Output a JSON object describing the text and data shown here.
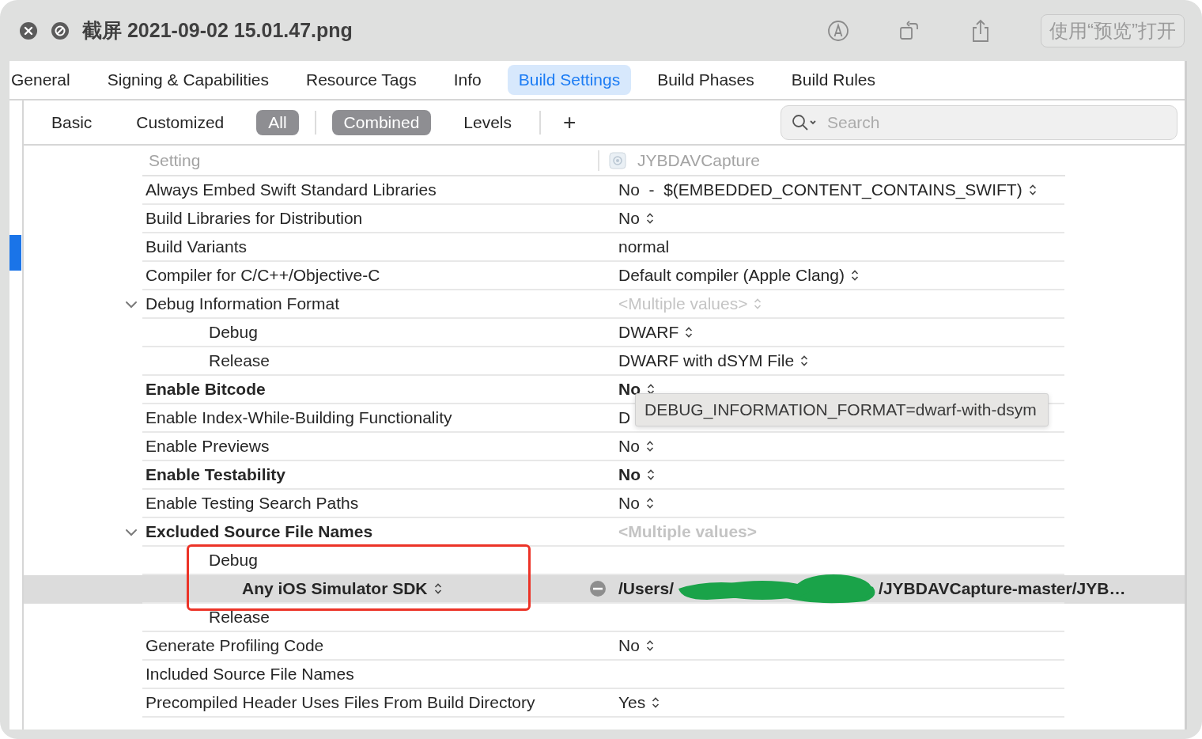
{
  "window": {
    "title": "截屏 2021-09-02 15.01.47.png",
    "open_button": "使用“预览”打开"
  },
  "tabs": [
    {
      "label": "General",
      "selected": false
    },
    {
      "label": "Signing & Capabilities",
      "selected": false
    },
    {
      "label": "Resource Tags",
      "selected": false
    },
    {
      "label": "Info",
      "selected": false
    },
    {
      "label": "Build Settings",
      "selected": true
    },
    {
      "label": "Build Phases",
      "selected": false
    },
    {
      "label": "Build Rules",
      "selected": false
    }
  ],
  "filter_bar": {
    "scopes": [
      {
        "label": "Basic",
        "selected": false
      },
      {
        "label": "Customized",
        "selected": false
      },
      {
        "label": "All",
        "selected": true
      }
    ],
    "modes": [
      {
        "label": "Combined",
        "selected": true
      },
      {
        "label": "Levels",
        "selected": false
      }
    ],
    "add_button": "+",
    "search": {
      "placeholder": "Search"
    }
  },
  "table": {
    "columns": [
      "Setting",
      "JYBDAVCapture"
    ],
    "rows": [
      {
        "name": "Always Embed Swift Standard Libraries",
        "value": "No  -  $(EMBEDDED_CONTENT_CONTAINS_SWIFT)",
        "popup": true,
        "bold": false,
        "selected": false
      },
      {
        "name": "Build Libraries for Distribution",
        "value": "No",
        "popup": true,
        "bold": false,
        "selected": false
      },
      {
        "name": "Build Variants",
        "value": "normal",
        "popup": false,
        "bold": false,
        "selected": false
      },
      {
        "name": "Compiler for C/C++/Objective-C",
        "value": "Default compiler (Apple Clang)",
        "popup": true,
        "bold": false,
        "selected": false
      },
      {
        "name": "Debug Information Format",
        "value": "<Multiple values>",
        "muted": true,
        "popup": true,
        "bold": false,
        "selected": false,
        "expanded": true,
        "children": [
          {
            "name": "Debug",
            "value": "DWARF",
            "popup": true,
            "bold": false,
            "selected": false
          },
          {
            "name": "Release",
            "value": "DWARF with dSYM File",
            "popup": true,
            "bold": false,
            "selected": false
          }
        ]
      },
      {
        "name": "Enable Bitcode",
        "value": "No",
        "popup": true,
        "bold": true,
        "selected": false
      },
      {
        "name": "Enable Index-While-Building Functionality",
        "value": "D",
        "popup": false,
        "bold": false,
        "selected": false
      },
      {
        "name": "Enable Previews",
        "value": "No",
        "popup": true,
        "bold": false,
        "selected": false
      },
      {
        "name": "Enable Testability",
        "value": "No",
        "popup": true,
        "bold": true,
        "selected": false
      },
      {
        "name": "Enable Testing Search Paths",
        "value": "No",
        "popup": true,
        "bold": false,
        "selected": false
      },
      {
        "name": "Excluded Source File Names",
        "value": "<Multiple values>",
        "muted": true,
        "popup": false,
        "bold": true,
        "selected": false,
        "expanded": true,
        "children": [
          {
            "name": "Debug",
            "bold": false,
            "selected": false,
            "children": [
              {
                "name": "Any iOS Simulator SDK",
                "name_popup": true,
                "removable": true,
                "value_parts": [
                  "/Users/",
                  "/JYBDAVCapture-master/JYB…"
                ],
                "redacted": true,
                "bold": true,
                "selected": true
              }
            ]
          },
          {
            "name": "Release",
            "bold": false,
            "selected": false
          }
        ]
      },
      {
        "name": "Generate Profiling Code",
        "value": "No",
        "popup": true,
        "bold": false,
        "selected": false
      },
      {
        "name": "Included Source File Names",
        "bold": false,
        "selected": false
      },
      {
        "name": "Precompiled Header Uses Files From Build Directory",
        "value": "Yes",
        "popup": true,
        "bold": false,
        "selected": false
      }
    ]
  },
  "tooltip": "DEBUG_INFORMATION_FORMAT=dwarf-with-dsym",
  "annotation": {
    "kind": "highlight-rectangle"
  }
}
